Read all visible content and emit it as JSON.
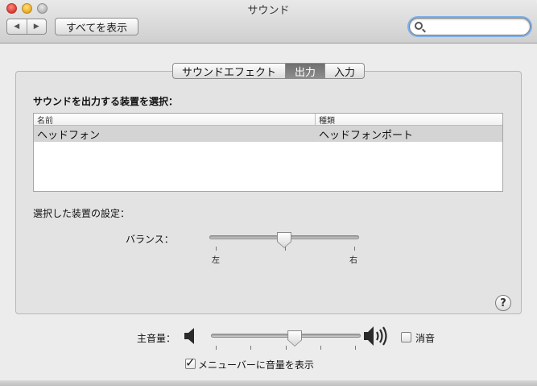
{
  "window": {
    "title": "サウンド"
  },
  "toolbar": {
    "back_glyph": "◀",
    "forward_glyph": "▶",
    "show_all_label": "すべてを表示",
    "search_value": "",
    "search_placeholder": ""
  },
  "tabs": [
    {
      "label": "サウンドエフェクト",
      "active": false
    },
    {
      "label": "出力",
      "active": true
    },
    {
      "label": "入力",
      "active": false
    }
  ],
  "output": {
    "heading": "サウンドを出力する装置を選択：",
    "columns": [
      "名前",
      "種類"
    ],
    "rows": [
      {
        "name": "ヘッドフォン",
        "type": "ヘッドフォンポート",
        "selected": true
      }
    ],
    "settings_heading": "選択した装置の設定：",
    "balance": {
      "label": "バランス：",
      "left_label": "左",
      "right_label": "右",
      "value": 0.5
    },
    "help_glyph": "?"
  },
  "volume": {
    "label": "主音量：",
    "value": 0.56,
    "mute_label": "消音",
    "mute_checked": false,
    "show_in_menubar_label": "メニューバーに音量を表示",
    "show_in_menubar_checked": true,
    "check_glyph": "✓"
  }
}
